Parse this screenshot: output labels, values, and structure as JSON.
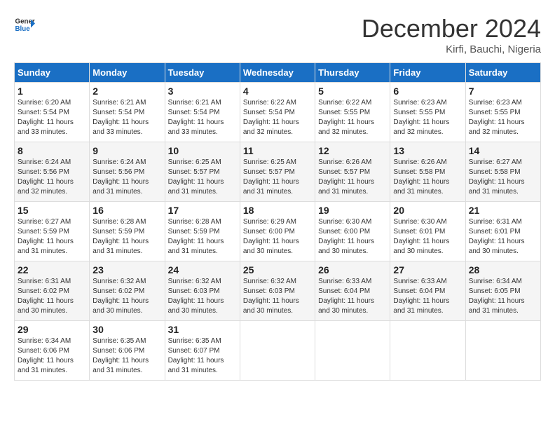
{
  "header": {
    "logo_line1": "General",
    "logo_line2": "Blue",
    "month_title": "December 2024",
    "location": "Kirfi, Bauchi, Nigeria"
  },
  "calendar": {
    "days_of_week": [
      "Sunday",
      "Monday",
      "Tuesday",
      "Wednesday",
      "Thursday",
      "Friday",
      "Saturday"
    ],
    "weeks": [
      [
        {
          "day": "1",
          "info": "Sunrise: 6:20 AM\nSunset: 5:54 PM\nDaylight: 11 hours\nand 33 minutes."
        },
        {
          "day": "2",
          "info": "Sunrise: 6:21 AM\nSunset: 5:54 PM\nDaylight: 11 hours\nand 33 minutes."
        },
        {
          "day": "3",
          "info": "Sunrise: 6:21 AM\nSunset: 5:54 PM\nDaylight: 11 hours\nand 33 minutes."
        },
        {
          "day": "4",
          "info": "Sunrise: 6:22 AM\nSunset: 5:54 PM\nDaylight: 11 hours\nand 32 minutes."
        },
        {
          "day": "5",
          "info": "Sunrise: 6:22 AM\nSunset: 5:55 PM\nDaylight: 11 hours\nand 32 minutes."
        },
        {
          "day": "6",
          "info": "Sunrise: 6:23 AM\nSunset: 5:55 PM\nDaylight: 11 hours\nand 32 minutes."
        },
        {
          "day": "7",
          "info": "Sunrise: 6:23 AM\nSunset: 5:55 PM\nDaylight: 11 hours\nand 32 minutes."
        }
      ],
      [
        {
          "day": "8",
          "info": "Sunrise: 6:24 AM\nSunset: 5:56 PM\nDaylight: 11 hours\nand 32 minutes."
        },
        {
          "day": "9",
          "info": "Sunrise: 6:24 AM\nSunset: 5:56 PM\nDaylight: 11 hours\nand 31 minutes."
        },
        {
          "day": "10",
          "info": "Sunrise: 6:25 AM\nSunset: 5:57 PM\nDaylight: 11 hours\nand 31 minutes."
        },
        {
          "day": "11",
          "info": "Sunrise: 6:25 AM\nSunset: 5:57 PM\nDaylight: 11 hours\nand 31 minutes."
        },
        {
          "day": "12",
          "info": "Sunrise: 6:26 AM\nSunset: 5:57 PM\nDaylight: 11 hours\nand 31 minutes."
        },
        {
          "day": "13",
          "info": "Sunrise: 6:26 AM\nSunset: 5:58 PM\nDaylight: 11 hours\nand 31 minutes."
        },
        {
          "day": "14",
          "info": "Sunrise: 6:27 AM\nSunset: 5:58 PM\nDaylight: 11 hours\nand 31 minutes."
        }
      ],
      [
        {
          "day": "15",
          "info": "Sunrise: 6:27 AM\nSunset: 5:59 PM\nDaylight: 11 hours\nand 31 minutes."
        },
        {
          "day": "16",
          "info": "Sunrise: 6:28 AM\nSunset: 5:59 PM\nDaylight: 11 hours\nand 31 minutes."
        },
        {
          "day": "17",
          "info": "Sunrise: 6:28 AM\nSunset: 5:59 PM\nDaylight: 11 hours\nand 31 minutes."
        },
        {
          "day": "18",
          "info": "Sunrise: 6:29 AM\nSunset: 6:00 PM\nDaylight: 11 hours\nand 30 minutes."
        },
        {
          "day": "19",
          "info": "Sunrise: 6:30 AM\nSunset: 6:00 PM\nDaylight: 11 hours\nand 30 minutes."
        },
        {
          "day": "20",
          "info": "Sunrise: 6:30 AM\nSunset: 6:01 PM\nDaylight: 11 hours\nand 30 minutes."
        },
        {
          "day": "21",
          "info": "Sunrise: 6:31 AM\nSunset: 6:01 PM\nDaylight: 11 hours\nand 30 minutes."
        }
      ],
      [
        {
          "day": "22",
          "info": "Sunrise: 6:31 AM\nSunset: 6:02 PM\nDaylight: 11 hours\nand 30 minutes."
        },
        {
          "day": "23",
          "info": "Sunrise: 6:32 AM\nSunset: 6:02 PM\nDaylight: 11 hours\nand 30 minutes."
        },
        {
          "day": "24",
          "info": "Sunrise: 6:32 AM\nSunset: 6:03 PM\nDaylight: 11 hours\nand 30 minutes."
        },
        {
          "day": "25",
          "info": "Sunrise: 6:32 AM\nSunset: 6:03 PM\nDaylight: 11 hours\nand 30 minutes."
        },
        {
          "day": "26",
          "info": "Sunrise: 6:33 AM\nSunset: 6:04 PM\nDaylight: 11 hours\nand 30 minutes."
        },
        {
          "day": "27",
          "info": "Sunrise: 6:33 AM\nSunset: 6:04 PM\nDaylight: 11 hours\nand 31 minutes."
        },
        {
          "day": "28",
          "info": "Sunrise: 6:34 AM\nSunset: 6:05 PM\nDaylight: 11 hours\nand 31 minutes."
        }
      ],
      [
        {
          "day": "29",
          "info": "Sunrise: 6:34 AM\nSunset: 6:06 PM\nDaylight: 11 hours\nand 31 minutes."
        },
        {
          "day": "30",
          "info": "Sunrise: 6:35 AM\nSunset: 6:06 PM\nDaylight: 11 hours\nand 31 minutes."
        },
        {
          "day": "31",
          "info": "Sunrise: 6:35 AM\nSunset: 6:07 PM\nDaylight: 11 hours\nand 31 minutes."
        },
        {
          "day": "",
          "info": ""
        },
        {
          "day": "",
          "info": ""
        },
        {
          "day": "",
          "info": ""
        },
        {
          "day": "",
          "info": ""
        }
      ]
    ]
  }
}
